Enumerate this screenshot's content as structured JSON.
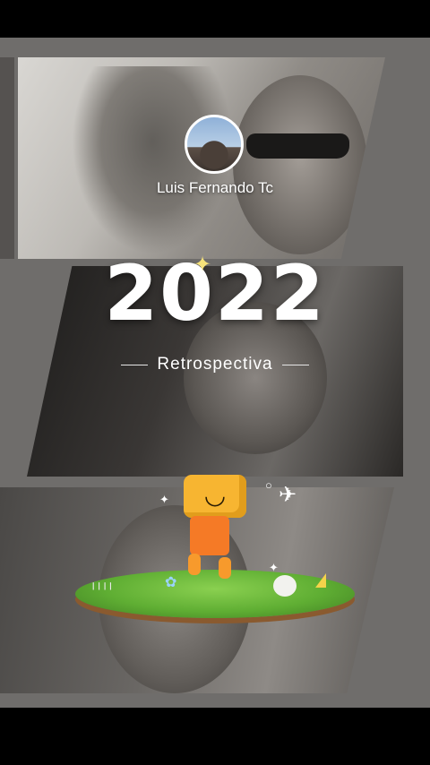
{
  "profile": {
    "name": "Luis Fernando Tc"
  },
  "recap": {
    "year": "2022",
    "subtitle": "Retrospectiva"
  },
  "decor": {
    "accent": "#f7b531",
    "grass": "#5fae33",
    "icons": [
      "sparkle-icon",
      "paper-plane-icon",
      "robot-mascot",
      "grass-island"
    ]
  }
}
